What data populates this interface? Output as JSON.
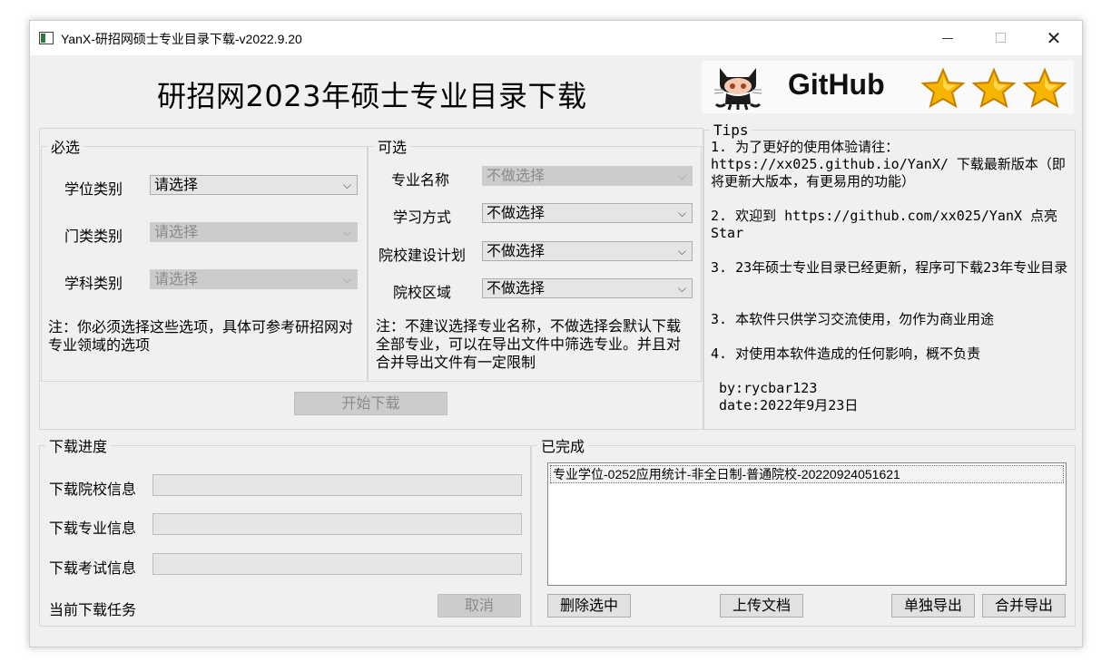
{
  "window": {
    "title": "YanX-研招网硕士专业目录下载-v2022.9.20"
  },
  "header": {
    "main_title": "研招网2023年硕士专业目录下载",
    "github_text": "GitHub"
  },
  "required": {
    "legend": "必选",
    "degree_label": "学位类别",
    "degree_value": "请选择",
    "category_label": "门类类别",
    "category_value": "请选择",
    "subject_label": "学科类别",
    "subject_value": "请选择",
    "note": "注：你必须选择这些选项，具体可参考研招网对专业领域的选项"
  },
  "optional": {
    "legend": "可选",
    "major_label": "专业名称",
    "major_value": "不做选择",
    "study_label": "学习方式",
    "study_value": "不做选择",
    "plan_label": "院校建设计划",
    "plan_value": "不做选择",
    "region_label": "院校区域",
    "region_value": "不做选择",
    "note": "注：不建议选择专业名称，不做选择会默认下载全部专业，可以在导出文件中筛选专业。并且对合并导出文件有一定限制"
  },
  "start_button": "开始下载",
  "tips": {
    "legend": "Tips",
    "t1": "1. 为了更好的使用体验请往：https://xx025.github.io/YanX/ 下载最新版本（即将更新大版本，有更易用的功能）",
    "t2": "2. 欢迎到 https://github.com/xx025/YanX 点亮 Star",
    "t3": "3. 23年硕士专业目录已经更新，程序可下载23年专业目录",
    "t4": "3. 本软件只供学习交流使用，勿作为商业用途",
    "t5": "4. 对使用本软件造成的任何影响，概不负责",
    "by": "by:rycbar123",
    "date": "date:2022年9月23日"
  },
  "progress": {
    "legend": "下载进度",
    "school_label": "下载院校信息",
    "major_label": "下载专业信息",
    "exam_label": "下载考试信息",
    "task_label": "当前下载任务",
    "cancel": "取消",
    "school_value": 0,
    "major_value": 0,
    "exam_value": 0
  },
  "completed": {
    "legend": "已完成",
    "items": [
      "专业学位-0252应用统计-非全日制-普通院校-20220924051621"
    ],
    "delete": "删除选中",
    "upload": "上传文档",
    "export_single": "单独导出",
    "export_merge": "合并导出"
  }
}
